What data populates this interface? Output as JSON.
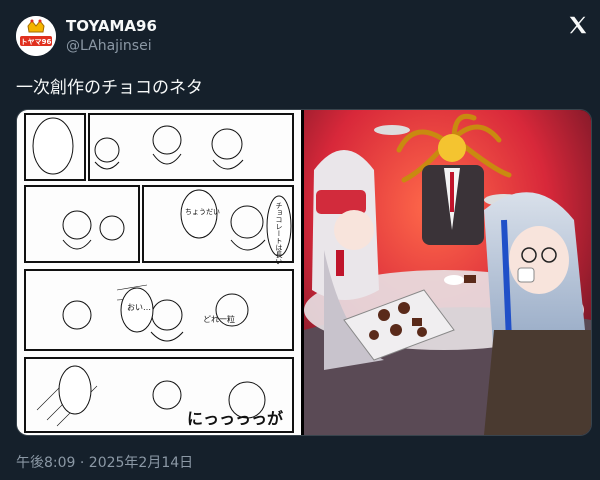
{
  "author": {
    "name": "TOYAMA96",
    "handle": "@LAhajinsei",
    "avatar_icon": "crowned-avatar-icon",
    "avatar_text": "トヤマ96"
  },
  "tweet": {
    "text": "一次創作のチョコのネタ",
    "timestamp": "午後8:09 · 2025年2月14日"
  },
  "media": {
    "left_image": "manga-comic-page-image",
    "right_image": "chocolate-tea-party-illustration-image",
    "manga_texts": [
      "チョコレートは長い",
      "にっっっっが",
      "おい…",
      "ちょうだい",
      "どれ一粒"
    ]
  },
  "colors": {
    "background": "#15202b",
    "text_primary": "#f7f9f9",
    "text_secondary": "#8b98a5",
    "border": "#38444d"
  }
}
